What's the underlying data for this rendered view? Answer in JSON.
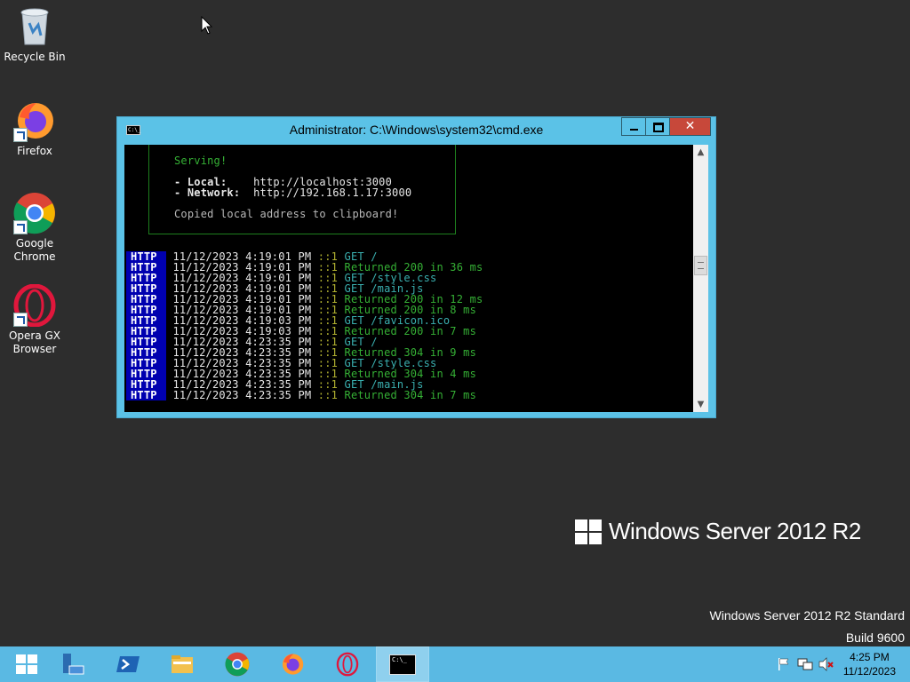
{
  "desktop": {
    "icons": [
      {
        "label": "Recycle Bin"
      },
      {
        "label": "Firefox"
      },
      {
        "label": "Google Chrome"
      },
      {
        "label": "Opera GX Browser"
      }
    ]
  },
  "window": {
    "title": "Administrator:  C:\\Windows\\system32\\cmd.exe",
    "close_label": "✕",
    "icon_text": "C:\\_"
  },
  "console": {
    "serving": "Serving!",
    "local_label": "- Local:",
    "local_url": "http://localhost:3000",
    "network_label": "- Network:",
    "network_url": "http://192.168.1.17:3000",
    "copied": "Copied local address to clipboard!",
    "log": [
      {
        "tag": "HTTP",
        "ts": "11/12/2023 4:19:01 PM",
        "ip": "::1",
        "msg": "GET /",
        "kind": "get"
      },
      {
        "tag": "HTTP",
        "ts": "11/12/2023 4:19:01 PM",
        "ip": "::1",
        "msg": "Returned 200 in 36 ms",
        "kind": "ret"
      },
      {
        "tag": "HTTP",
        "ts": "11/12/2023 4:19:01 PM",
        "ip": "::1",
        "msg": "GET /style.css",
        "kind": "get"
      },
      {
        "tag": "HTTP",
        "ts": "11/12/2023 4:19:01 PM",
        "ip": "::1",
        "msg": "GET /main.js",
        "kind": "get"
      },
      {
        "tag": "HTTP",
        "ts": "11/12/2023 4:19:01 PM",
        "ip": "::1",
        "msg": "Returned 200 in 12 ms",
        "kind": "ret"
      },
      {
        "tag": "HTTP",
        "ts": "11/12/2023 4:19:01 PM",
        "ip": "::1",
        "msg": "Returned 200 in 8 ms",
        "kind": "ret"
      },
      {
        "tag": "HTTP",
        "ts": "11/12/2023 4:19:03 PM",
        "ip": "::1",
        "msg": "GET /favicon.ico",
        "kind": "get"
      },
      {
        "tag": "HTTP",
        "ts": "11/12/2023 4:19:03 PM",
        "ip": "::1",
        "msg": "Returned 200 in 7 ms",
        "kind": "ret"
      },
      {
        "tag": "HTTP",
        "ts": "11/12/2023 4:23:35 PM",
        "ip": "::1",
        "msg": "GET /",
        "kind": "get"
      },
      {
        "tag": "HTTP",
        "ts": "11/12/2023 4:23:35 PM",
        "ip": "::1",
        "msg": "Returned 304 in 9 ms",
        "kind": "ret"
      },
      {
        "tag": "HTTP",
        "ts": "11/12/2023 4:23:35 PM",
        "ip": "::1",
        "msg": "GET /style.css",
        "kind": "get"
      },
      {
        "tag": "HTTP",
        "ts": "11/12/2023 4:23:35 PM",
        "ip": "::1",
        "msg": "Returned 304 in 4 ms",
        "kind": "ret"
      },
      {
        "tag": "HTTP",
        "ts": "11/12/2023 4:23:35 PM",
        "ip": "::1",
        "msg": "GET /main.js",
        "kind": "get"
      },
      {
        "tag": "HTTP",
        "ts": "11/12/2023 4:23:35 PM",
        "ip": "::1",
        "msg": "Returned 304 in 7 ms",
        "kind": "ret"
      }
    ]
  },
  "branding": {
    "product": "Windows Server 2012 R2",
    "edition": "Windows Server 2012 R2 Standard",
    "build": "Build 9600"
  },
  "taskbar": {
    "items": [
      "start-icon",
      "server-manager-icon",
      "powershell-icon",
      "file-explorer-icon",
      "chrome-icon",
      "firefox-icon",
      "opera-icon",
      "cmd-icon"
    ],
    "cmd_text": "C:\\_",
    "time": "4:25 PM",
    "date": "11/12/2023"
  },
  "colors": {
    "desktop": "#2d2d2d",
    "window_frame": "#5bc2e7",
    "taskbar": "#5ab9e3",
    "close_button": "#c7483a",
    "http_badge": "#0000b0"
  }
}
